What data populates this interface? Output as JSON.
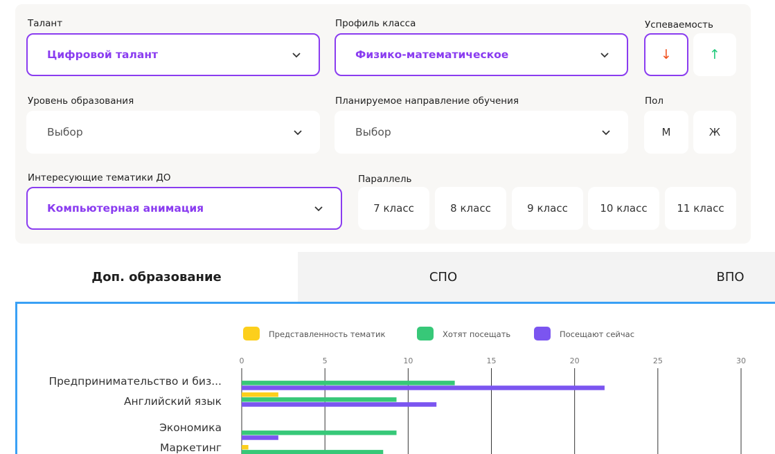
{
  "filters": {
    "talent": {
      "label": "Талант",
      "value": "Цифровой талант"
    },
    "class_profile": {
      "label": "Профиль класса",
      "value": "Физико-математическое"
    },
    "performance": {
      "label": "Успеваемость",
      "down": "↓",
      "up": "↑",
      "down_color": "#f0521f",
      "up_color": "#1fc97a"
    },
    "education_level": {
      "label": "Уровень образования",
      "value": "Выбор"
    },
    "planned_direction": {
      "label": "Планируемое направление обучения",
      "value": "Выбор"
    },
    "gender": {
      "label": "Пол",
      "male": "М",
      "female": "Ж"
    },
    "topics": {
      "label": "Интересующие тематики ДО",
      "value": "Компьютерная анимация"
    },
    "parallel": {
      "label": "Параллель",
      "options": [
        "7 класс",
        "8 класс",
        "9 класс",
        "10 класс",
        "11 класс"
      ]
    }
  },
  "tabs": [
    {
      "label": "Доп. образование",
      "active": true
    },
    {
      "label": "СПО",
      "active": false
    },
    {
      "label": "ВПО",
      "active": false
    }
  ],
  "chart_data": {
    "type": "bar",
    "orientation": "horizontal",
    "legend_position": "top",
    "grid": true,
    "xlim": [
      0,
      30
    ],
    "x_ticks": [
      0,
      5,
      10,
      15,
      20,
      25,
      30
    ],
    "categories": [
      "Предпринимательство и биз...",
      "Английский язык",
      "Экономика",
      "Маркетинг"
    ],
    "series": [
      {
        "name": "Представленность тематик",
        "color": "#fccf1c",
        "values": [
          0,
          2.2,
          0,
          0.4
        ]
      },
      {
        "name": "Хотят посещать",
        "color": "#37c878",
        "values": [
          12.8,
          9.3,
          9.3,
          8.5
        ]
      },
      {
        "name": "Посещают сейчас",
        "color": "#7b55f0",
        "values": [
          21.8,
          11.7,
          2.2,
          0
        ]
      }
    ]
  }
}
